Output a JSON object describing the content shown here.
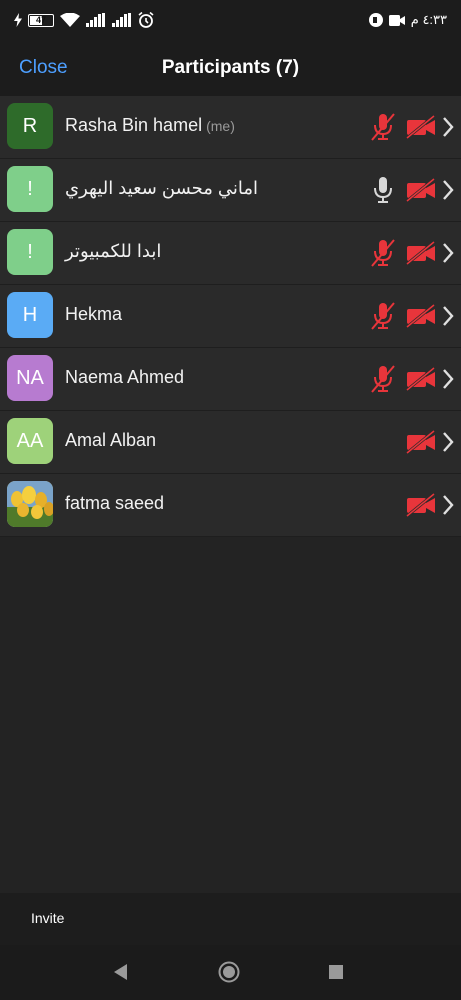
{
  "status_bar": {
    "battery_level": "47",
    "time": "٤:٣٣ م",
    "icons": [
      "charging-icon",
      "battery-icon",
      "wifi-icon",
      "signal-icon",
      "signal-icon",
      "alarm-icon",
      "app-icon",
      "video-icon"
    ]
  },
  "header": {
    "close_label": "Close",
    "title": "Participants (7)"
  },
  "participants": [
    {
      "initials": "R",
      "name": "Rasha Bin hamel",
      "tag": "(me)",
      "avatar_color": "#2e6b2a",
      "mic": "muted",
      "camera": "off"
    },
    {
      "initials": "!",
      "name": "اماني محسن سعيد اليهري",
      "tag": "",
      "avatar_color": "#7fcf8a",
      "mic": "on",
      "camera": "off"
    },
    {
      "initials": "!",
      "name": "ابدا للكمبيوتر",
      "tag": "",
      "avatar_color": "#7fcf8a",
      "mic": "muted",
      "camera": "off"
    },
    {
      "initials": "H",
      "name": "Hekma",
      "tag": "",
      "avatar_color": "#5aabf5",
      "mic": "muted",
      "camera": "off"
    },
    {
      "initials": "NA",
      "name": "Naema Ahmed",
      "tag": "",
      "avatar_color": "#b77bd0",
      "mic": "muted",
      "camera": "off"
    },
    {
      "initials": "AA",
      "name": "Amal Alban",
      "tag": "",
      "avatar_color": "#9ed27a",
      "mic": "none",
      "camera": "off"
    },
    {
      "initials": "",
      "name": "fatma saeed",
      "tag": "",
      "avatar_color": "#c9a227",
      "mic": "none",
      "camera": "off",
      "avatar_image": "tulips-photo"
    }
  ],
  "footer": {
    "invite_label": "Invite"
  },
  "colors": {
    "accent": "#4d9fff",
    "muted_red": "#e8353b",
    "background": "#232323",
    "row_background": "#2a2a2a"
  }
}
